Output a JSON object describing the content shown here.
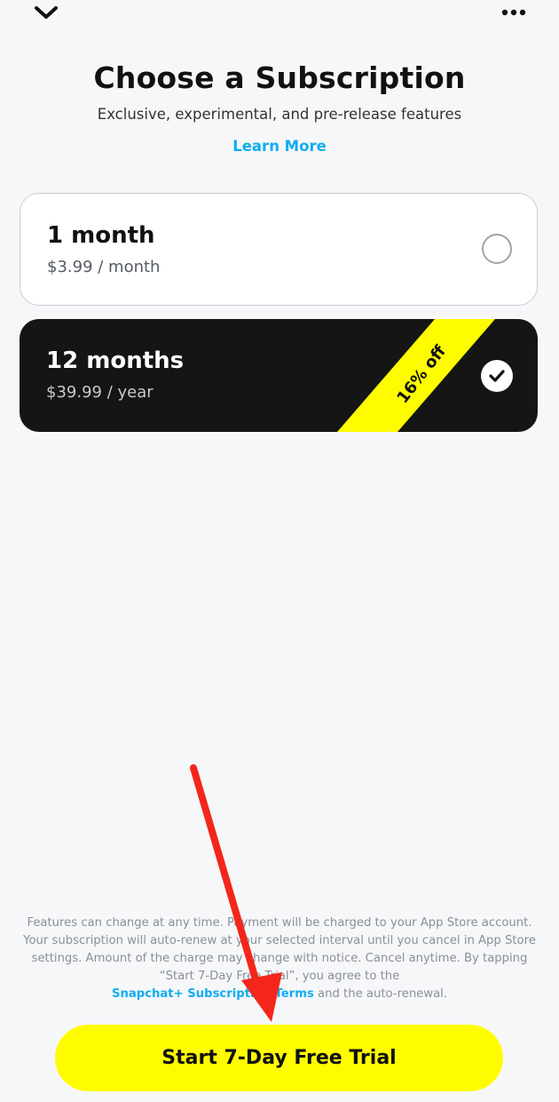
{
  "header": {
    "back_icon": "chevron-down-icon",
    "more_icon": "more-horizontal-icon"
  },
  "title": "Choose a Subscription",
  "subtitle": "Exclusive, experimental, and pre-release features",
  "learn_more": "Learn More",
  "plans": [
    {
      "name": "1 month",
      "price": "$3.99 / month",
      "selected": false
    },
    {
      "name": "12 months",
      "price": "$39.99 / year",
      "selected": true,
      "badge": "16% off"
    }
  ],
  "legal": {
    "line1": "Features can change at any time. Payment will be charged to your App Store account.",
    "line2": "Your subscription will auto-renew at your selected interval until you cancel in App Store",
    "line3": "settings. Amount of the charge may change with notice. Cancel anytime. By tapping",
    "line4": "“Start 7-Day Free Trial”, you agree to the",
    "link": "Snapchat+ Subscription Terms",
    "tail": " and the auto-renewal."
  },
  "cta_label": "Start 7-Day Free Trial",
  "colors": {
    "accent_yellow": "#fffc00",
    "link_blue": "#0fadf0",
    "selected_card": "#151515",
    "annotation_arrow": "#f4261b"
  }
}
